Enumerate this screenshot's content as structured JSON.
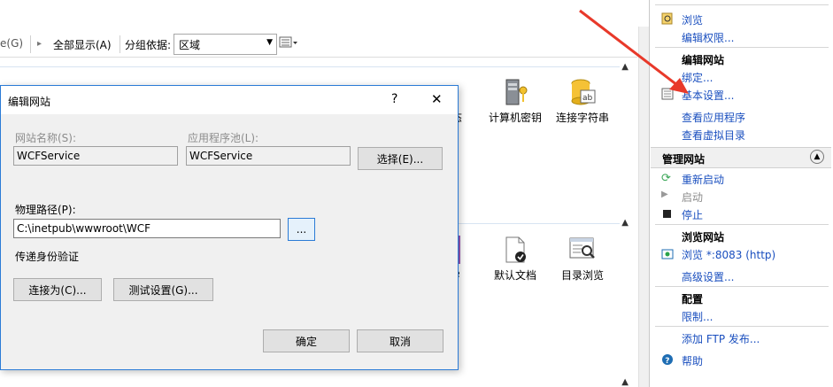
{
  "toolbar": {
    "go_label": "e(G)",
    "show_all_label": "全部显示(A)",
    "group_by_label": "分组依据:",
    "group_value": "区域"
  },
  "features": {
    "row1": [
      "态",
      "计算机密钥",
      "连接字符串"
    ],
    "row2": [
      "e",
      "默认文档",
      "目录浏览"
    ]
  },
  "actions": {
    "browse": "浏览",
    "edit_permissions": "编辑权限...",
    "edit_site_head": "编辑网站",
    "bindings": "绑定...",
    "basic_settings": "基本设置...",
    "view_apps": "查看应用程序",
    "view_vdirs": "查看虚拟目录",
    "manage_site_head": "管理网站",
    "restart": "重新启动",
    "start": "启动",
    "stop": "停止",
    "browse_site_head": "浏览网站",
    "browse_port": "浏览 *:8083 (http)",
    "advanced_settings": "高级设置...",
    "config_head": "配置",
    "limits": "限制...",
    "add_ftp": "添加 FTP 发布...",
    "help": "帮助"
  },
  "dialog": {
    "title": "编辑网站",
    "help_glyph": "?",
    "close_glyph": "✕",
    "site_name_label": "网站名称(S):",
    "site_name_value": "WCFService",
    "app_pool_label": "应用程序池(L):",
    "app_pool_value": "WCFService",
    "select_button": "选择(E)...",
    "physical_path_label": "物理路径(P):",
    "physical_path_value": "C:\\inetpub\\wwwroot\\WCF",
    "browse_button": "...",
    "pass_auth_label": "传递身份验证",
    "connect_as_button": "连接为(C)...",
    "test_settings_button": "测试设置(G)...",
    "ok_button": "确定",
    "cancel_button": "取消"
  },
  "colors": {
    "link": "#1a4fbf",
    "arrow": "#e8392a",
    "dialog_border": "#2b7bd6"
  }
}
